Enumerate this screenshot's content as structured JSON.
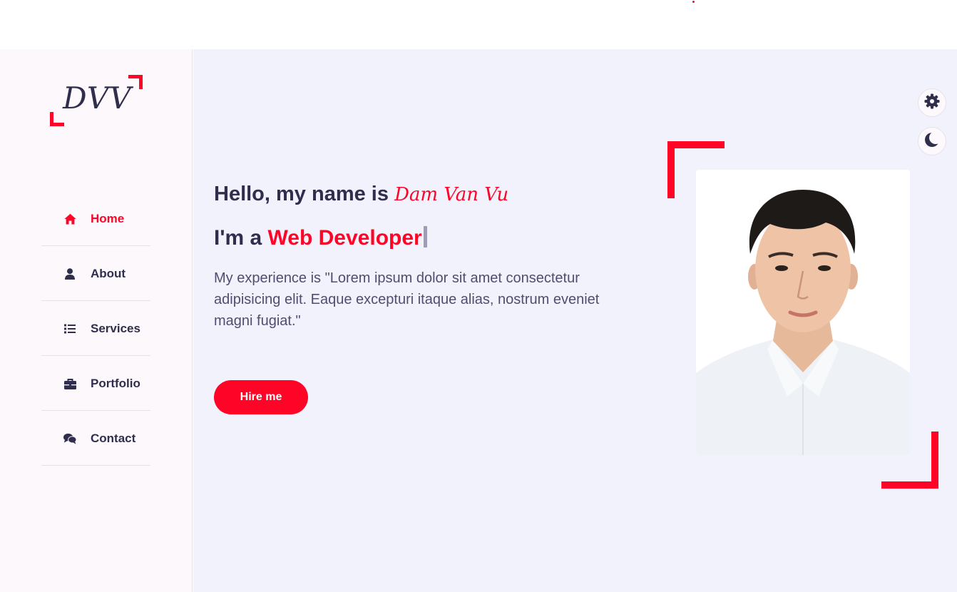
{
  "colors": {
    "accent": "#fe0528",
    "text_dark": "#302e4d",
    "text_body": "#504e70",
    "aside_bg": "#fcf8fc",
    "main_bg": "#f2f2fc"
  },
  "logo": {
    "text": "DVV"
  },
  "nav": {
    "items": [
      {
        "label": "Home",
        "icon": "home-icon",
        "active": true
      },
      {
        "label": "About",
        "icon": "user-icon",
        "active": false
      },
      {
        "label": "Services",
        "icon": "list-icon",
        "active": false
      },
      {
        "label": "Portfolio",
        "icon": "briefcase-icon",
        "active": false
      },
      {
        "label": "Contact",
        "icon": "comments-icon",
        "active": false
      }
    ]
  },
  "hero": {
    "greeting": "Hello, my name is",
    "name": "Dam Van Vu",
    "role_prefix": "I'm a",
    "role": "Web Developer",
    "description": "My experience is \"Lorem ipsum dolor sit amet consectetur adipisicing elit. Eaque excepturi itaque alias, nostrum eveniet magni fugiat.\"",
    "button_label": "Hire me"
  },
  "controls": {
    "settings_icon": "gear-icon",
    "theme_icon": "moon-icon"
  }
}
